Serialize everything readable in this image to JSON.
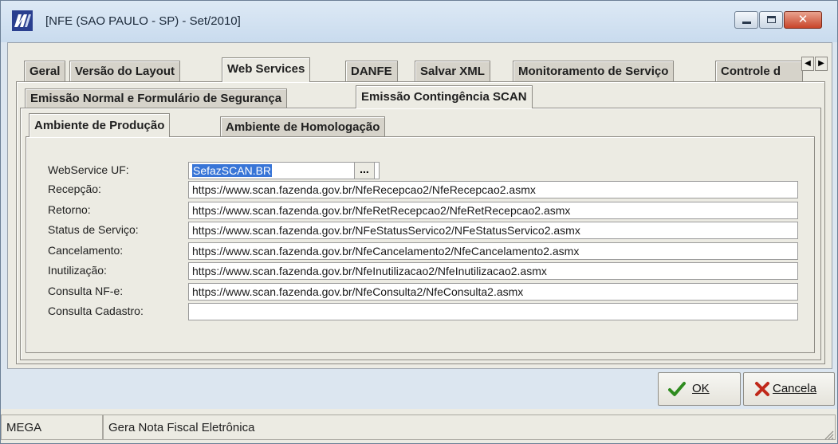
{
  "window": {
    "title": "[NFE (SAO PAULO - SP) - Set/2010]",
    "icons": {
      "app": "nfe-app-icon",
      "minimize": "minimize-icon",
      "maximize": "maximize-icon",
      "close": "close-icon"
    },
    "close_glyph": "✕"
  },
  "main_tabs": [
    {
      "label": "Geral",
      "active": false
    },
    {
      "label": "Versão do Layout",
      "active": false
    },
    {
      "label": "Web Services",
      "active": true
    },
    {
      "label": "DANFE",
      "active": false
    },
    {
      "label": "Salvar XML",
      "active": false
    },
    {
      "label": "Monitoramento de Serviço",
      "active": false
    },
    {
      "label": "Controle d",
      "active": false
    }
  ],
  "tab_scroll": {
    "left": "◀",
    "right": "▶"
  },
  "sub_tabs": [
    {
      "label": "Emissão Normal e Formulário de Segurança",
      "active": false
    },
    {
      "label": "Emissão Contingência SCAN",
      "active": true
    }
  ],
  "env_tabs": [
    {
      "label": "Ambiente de Produção",
      "active": true
    },
    {
      "label": "Ambiente de Homologação",
      "active": false
    }
  ],
  "form": {
    "uf_label": "WebService UF:",
    "uf_value": "SefazSCAN.BR",
    "lookup_label": "...",
    "fields": [
      {
        "label": "Recepção:",
        "value": "https://www.scan.fazenda.gov.br/NfeRecepcao2/NfeRecepcao2.asmx"
      },
      {
        "label": "Retorno:",
        "value": "https://www.scan.fazenda.gov.br/NfeRetRecepcao2/NfeRetRecepcao2.asmx"
      },
      {
        "label": "Status de Serviço:",
        "value": "https://www.scan.fazenda.gov.br/NFeStatusServico2/NFeStatusServico2.asmx"
      },
      {
        "label": "Cancelamento:",
        "value": "https://www.scan.fazenda.gov.br/NfeCancelamento2/NfeCancelamento2.asmx"
      },
      {
        "label": "Inutilização:",
        "value": "https://www.scan.fazenda.gov.br/NfeInutilizacao2/NfeInutilizacao2.asmx"
      },
      {
        "label": "Consulta NF-e:",
        "value": "https://www.scan.fazenda.gov.br/NfeConsulta2/NfeConsulta2.asmx"
      },
      {
        "label": "Consulta Cadastro:",
        "value": ""
      }
    ]
  },
  "buttons": {
    "ok": {
      "label": "OK",
      "icon": "checkmark-icon",
      "color": "#2e8b1f"
    },
    "cancel": {
      "label": "Cancela",
      "icon": "x-mark-icon",
      "color": "#c0281a"
    }
  },
  "status": {
    "left": "MEGA",
    "right": "Gera Nota Fiscal Eletrônica"
  },
  "colors": {
    "selection": "#3875d7",
    "title_bar": "#c9dbee",
    "face": "#ecebe3"
  }
}
